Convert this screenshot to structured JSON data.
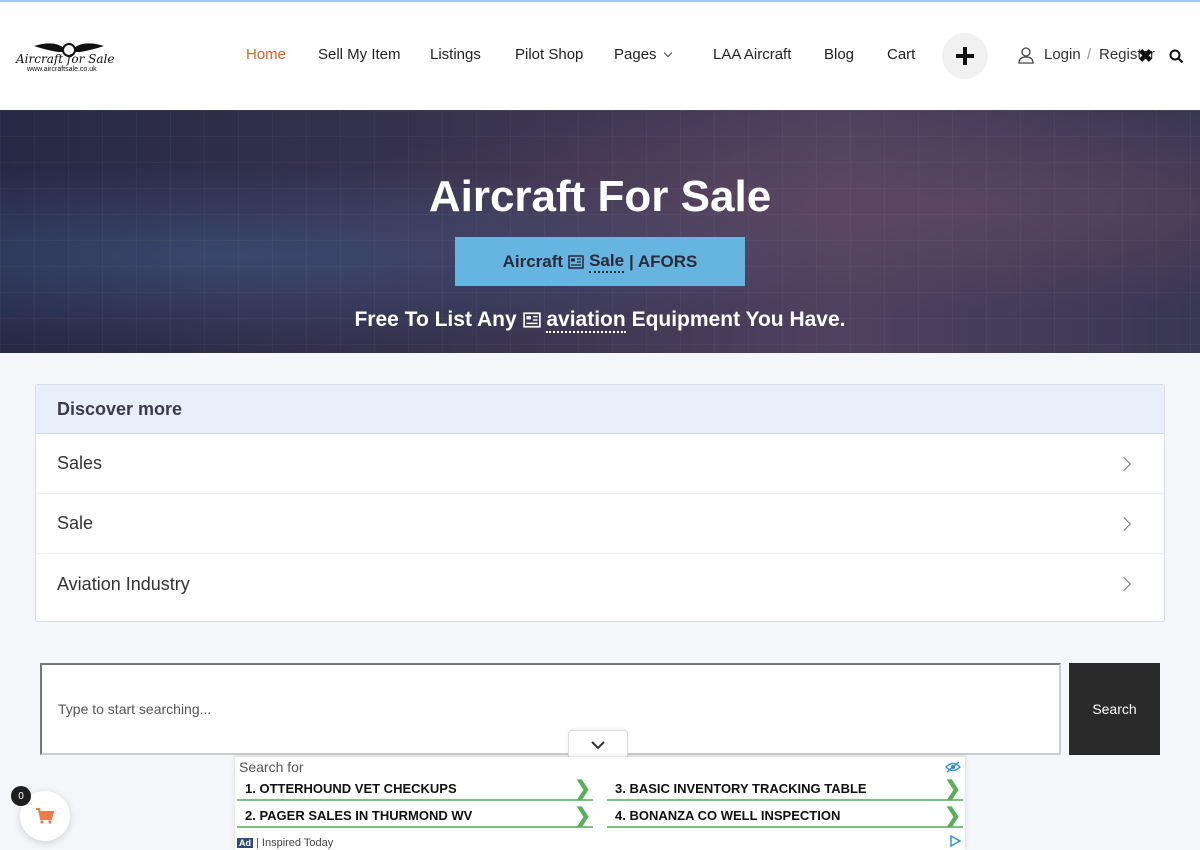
{
  "brand": {
    "logo_text": "Aircraft for Sale",
    "logo_url": "www.aircraftsale.co.uk"
  },
  "nav": {
    "items": [
      {
        "label": "Home"
      },
      {
        "label": "Sell My Item"
      },
      {
        "label": "Listings"
      },
      {
        "label": "Pilot Shop"
      },
      {
        "label": "Pages"
      },
      {
        "label": "LAA Aircraft"
      },
      {
        "label": "Blog"
      },
      {
        "label": "Cart"
      }
    ],
    "active": "Home",
    "login": "Login",
    "separator": "/",
    "register": "Register"
  },
  "hero": {
    "title": "Aircraft For Sale",
    "badge_prefix": "Aircraft",
    "badge_link": "Sale",
    "badge_suffix": "| AFORS",
    "sub_prefix": "Free To List Any",
    "sub_link": "aviation",
    "sub_suffix": "Equipment You Have."
  },
  "discover": {
    "heading": "Discover more",
    "items": [
      "Sales",
      "Sale",
      "Aviation Industry"
    ]
  },
  "search": {
    "placeholder": "Type to start searching...",
    "button": "Search"
  },
  "ad": {
    "label": "Search for",
    "links": [
      "1. OTTERHOUND VET CHECKUPS",
      "2. PAGER SALES IN THURMOND WV",
      "3. BASIC INVENTORY TRACKING TABLE",
      "4. BONANZA CO WELL INSPECTION"
    ],
    "badge": "Ad",
    "sponsor": "| Inspired Today"
  },
  "cart": {
    "count": "0"
  },
  "colors": {
    "accent": "#e0622a",
    "badge_bg": "#66b5e0",
    "search_button": "#2a2a2a"
  }
}
